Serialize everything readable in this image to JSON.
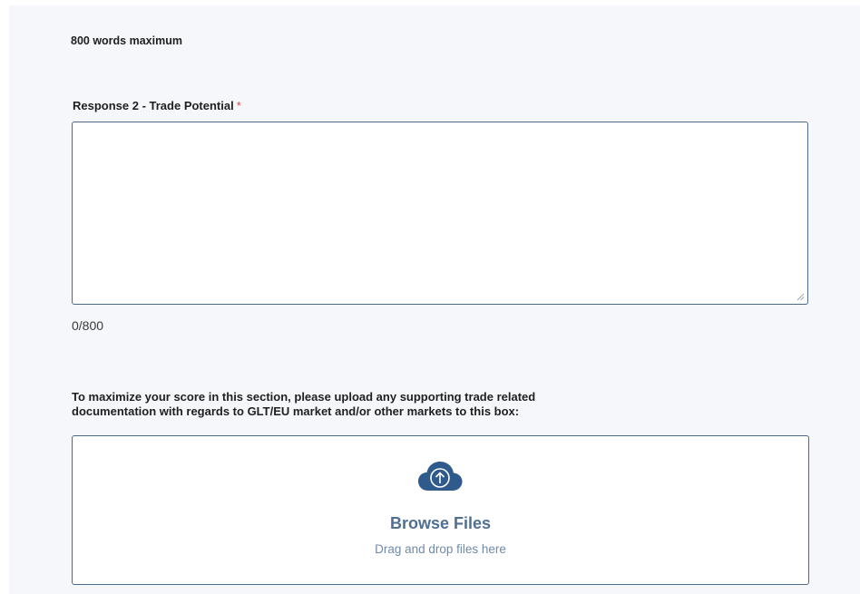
{
  "form": {
    "word_limit_text": "800 words maximum",
    "response_field": {
      "label": "Response 2 - Trade Potential",
      "required_marker": "*",
      "value": "",
      "placeholder": "",
      "counter": "0/800"
    },
    "upload": {
      "label_line1": "To maximize your score in this section, please upload any supporting trade related",
      "label_line2": "documentation with regards to GLT/EU market and/or other markets to this box:",
      "browse_label": "Browse Files",
      "drop_hint": "Drag and drop files here",
      "icon": "cloud-upload-icon"
    }
  },
  "colors": {
    "border": "#4b6a8a",
    "accent": "#4f6f93",
    "required": "#e04848",
    "background": "#f5f7fa"
  }
}
